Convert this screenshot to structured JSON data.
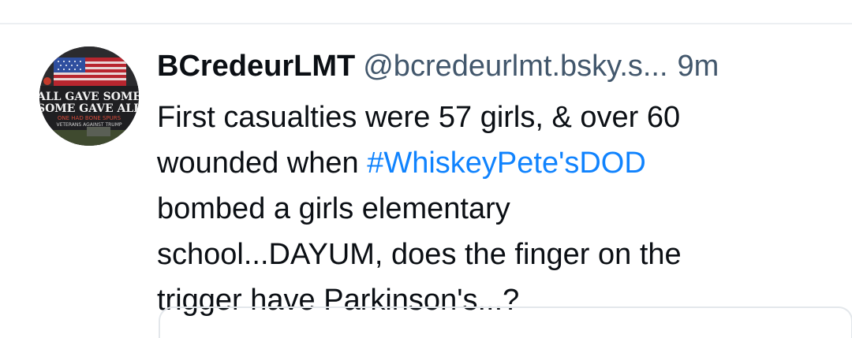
{
  "post": {
    "author": {
      "display_name": "BCredeurLMT",
      "handle": "@bcredeurlmt.bsky.s...",
      "avatar": {
        "icon": "flag-memorial-avatar",
        "text_line_1": "ALL GAVE SOME",
        "text_line_2": "SOME GAVE ALL",
        "text_line_3": "ONE HAD BONE SPURS",
        "text_line_4": "VETERANS AGAINST TRUMP"
      }
    },
    "time_ago": "9m",
    "text": {
      "line_1": "First casualties were 57 girls, & over 60",
      "line_2_before": "wounded when ",
      "line_2_hashtag": "#WhiskeyPete'sDOD",
      "line_3": "bombed a girls elementary",
      "line_4": "school...DAYUM, does the finger on the",
      "line_5": "trigger have Parkinson's...?"
    }
  },
  "colors": {
    "text_primary": "#0b0f14",
    "text_secondary": "#42576c",
    "link": "#1083fe",
    "divider": "#eceff2"
  }
}
